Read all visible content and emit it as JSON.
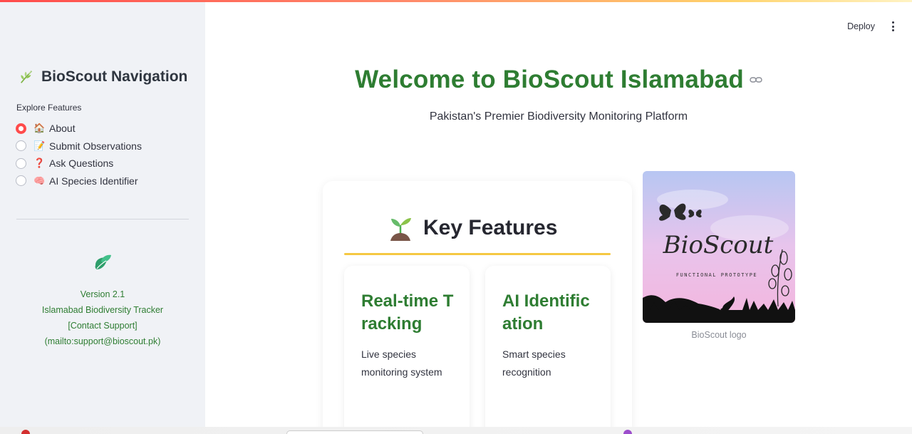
{
  "header": {
    "deploy_label": "Deploy"
  },
  "sidebar": {
    "title": "BioScout Navigation",
    "explore_label": "Explore Features",
    "options": [
      {
        "emoji": "🏠",
        "label": "About",
        "selected": true
      },
      {
        "emoji": "📝",
        "label": "Submit Observations",
        "selected": false
      },
      {
        "emoji": "❓",
        "label": "Ask Questions",
        "selected": false
      },
      {
        "emoji": "🧠",
        "label": "AI Species Identifier",
        "selected": false
      }
    ],
    "info": {
      "version": "Version 2.1",
      "tracker": "Islamabad Biodiversity Tracker",
      "contact": "[Contact Support]",
      "mailto": "(mailto:support@bioscout.pk)"
    }
  },
  "main": {
    "title": "Welcome to BioScout Islamabad",
    "subtitle": "Pakistan's Premier Biodiversity Monitoring Platform",
    "key_features_title": "Key Features",
    "features": [
      {
        "title": "Real-time Tracking",
        "description": "Live species monitoring system"
      },
      {
        "title": "AI Identification",
        "description": "Smart species recognition"
      }
    ],
    "logo": {
      "text": "BioScout",
      "tagline": "FUNCTIONAL PROTOTYPE",
      "caption": "BioScout logo"
    }
  },
  "colors": {
    "accent": "#ff4b4b",
    "brand_green": "#2e7d32",
    "underline_yellow": "#f5c842",
    "sidebar_bg": "#f0f2f6"
  }
}
